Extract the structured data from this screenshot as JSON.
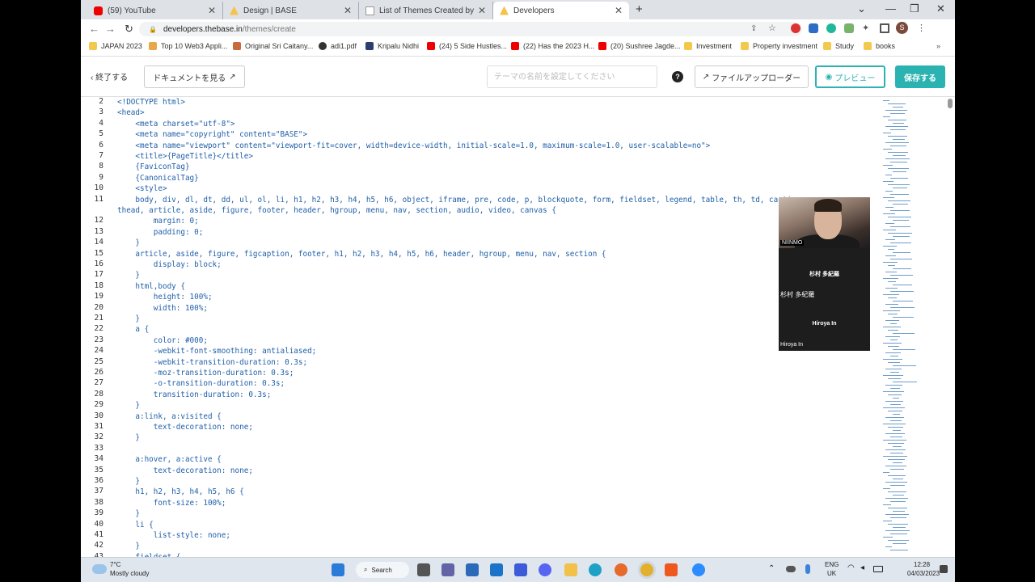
{
  "browser": {
    "tabs": [
      {
        "title": "(59) YouTube",
        "icon": "youtube-icon"
      },
      {
        "title": "Design | BASE",
        "icon": "doc-icon"
      },
      {
        "title": "List of Themes Created by HTML",
        "icon": "doc-icon"
      },
      {
        "title": "Developers",
        "icon": "base-icon"
      }
    ],
    "url_domain": "developers.thebase.in",
    "url_path": "/themes/create",
    "profile_initial": "S",
    "bookmarks": [
      "JAPAN 2023",
      "Top 10 Web3 Appli...",
      "Original Sri Caitany...",
      "adi1.pdf",
      "Kripalu Nidhi",
      "(24) 5 Side Hustles...",
      "(22) Has the 2023 H...",
      "(20) Sushree Jagde...",
      "Investment",
      "Property investment",
      "Study",
      "books"
    ]
  },
  "app_header": {
    "exit_label": "終了する",
    "docs_label": "ドキュメントを見る",
    "theme_name_placeholder": "テーマの名前を設定してください",
    "help_label": "?",
    "uploader_label": "ファイルアップローダー",
    "preview_label": "プレビュー",
    "save_label": "保存する"
  },
  "editor": {
    "lines": [
      {
        "n": "2",
        "t": "<!DOCTYPE html>"
      },
      {
        "n": "3",
        "t": "<head>"
      },
      {
        "n": "4",
        "t": "    <meta charset=\"utf-8\">"
      },
      {
        "n": "5",
        "t": "    <meta name=\"copyright\" content=\"BASE\">"
      },
      {
        "n": "6",
        "t": "    <meta name=\"viewport\" content=\"viewport-fit=cover, width=device-width, initial-scale=1.0, maximum-scale=1.0, user-scalable=no\">"
      },
      {
        "n": "7",
        "t": "    <title>{PageTitle}</title>"
      },
      {
        "n": "8",
        "t": "    {FaviconTag}"
      },
      {
        "n": "9",
        "t": "    {CanonicalTag}"
      },
      {
        "n": "10",
        "t": "    <style>"
      },
      {
        "n": "11",
        "t": "    body, div, dl, dt, dd, ul, ol, li, h1, h2, h3, h4, h5, h6, object, iframe, pre, code, p, blockquote, form, fieldset, legend, table, th, td, caption,"
      },
      {
        "n": "",
        "t": "thead, article, aside, figure, footer, header, hgroup, menu, nav, section, audio, video, canvas {"
      },
      {
        "n": "12",
        "t": "        margin: 0;"
      },
      {
        "n": "13",
        "t": "        padding: 0;"
      },
      {
        "n": "14",
        "t": "    }"
      },
      {
        "n": "15",
        "t": "    article, aside, figure, figcaption, footer, h1, h2, h3, h4, h5, h6, header, hgroup, menu, nav, section {"
      },
      {
        "n": "16",
        "t": "        display: block;"
      },
      {
        "n": "17",
        "t": "    }"
      },
      {
        "n": "18",
        "t": "    html,body {"
      },
      {
        "n": "19",
        "t": "        height: 100%;"
      },
      {
        "n": "20",
        "t": "        width: 100%;"
      },
      {
        "n": "21",
        "t": "    }"
      },
      {
        "n": "22",
        "t": "    a {"
      },
      {
        "n": "23",
        "t": "        color: #000;"
      },
      {
        "n": "24",
        "t": "        -webkit-font-smoothing: antialiased;"
      },
      {
        "n": "25",
        "t": "        -webkit-transition-duration: 0.3s;"
      },
      {
        "n": "26",
        "t": "        -moz-transition-duration: 0.3s;"
      },
      {
        "n": "27",
        "t": "        -o-transition-duration: 0.3s;"
      },
      {
        "n": "28",
        "t": "        transition-duration: 0.3s;"
      },
      {
        "n": "29",
        "t": "    }"
      },
      {
        "n": "30",
        "t": "    a:link, a:visited {"
      },
      {
        "n": "31",
        "t": "        text-decoration: none;"
      },
      {
        "n": "32",
        "t": "    }"
      },
      {
        "n": "33",
        "t": ""
      },
      {
        "n": "34",
        "t": "    a:hover, a:active {"
      },
      {
        "n": "35",
        "t": "        text-decoration: none;"
      },
      {
        "n": "36",
        "t": "    }"
      },
      {
        "n": "37",
        "t": "    h1, h2, h3, h4, h5, h6 {"
      },
      {
        "n": "38",
        "t": "        font-size: 100%;"
      },
      {
        "n": "39",
        "t": "    }"
      },
      {
        "n": "40",
        "t": "    li {"
      },
      {
        "n": "41",
        "t": "        list-style: none;"
      },
      {
        "n": "42",
        "t": "    }"
      },
      {
        "n": "43",
        "t": "    fieldset {"
      }
    ]
  },
  "video_call": {
    "self_label": "NIINMO",
    "participant1_card": "杉村 多紀羅",
    "participant1_name": "杉村 多紀羅",
    "participant2_card": "Hiroya In",
    "participant2_name": "Hiroya In"
  },
  "taskbar": {
    "weather_temp": "7°C",
    "weather_desc": "Mostly cloudy",
    "search_label": "Search",
    "lang": "ENG",
    "region": "UK",
    "time": "12:28",
    "date": "04/03/2023"
  },
  "colors": {
    "accent": "#2bb3b1",
    "code_text": "#1f5fa8"
  }
}
